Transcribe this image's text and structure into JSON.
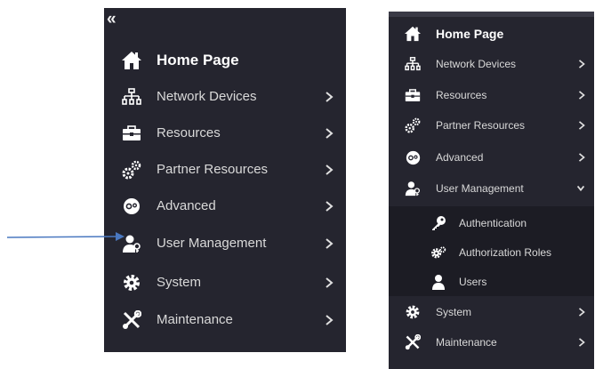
{
  "left_panel": {
    "collapse_glyph": "«",
    "items": [
      {
        "label": "Home Page",
        "icon": "home-icon"
      },
      {
        "label": "Network Devices",
        "icon": "network-icon"
      },
      {
        "label": "Resources",
        "icon": "briefcase-icon"
      },
      {
        "label": "Partner Resources",
        "icon": "gears-icon"
      },
      {
        "label": "Advanced",
        "icon": "advanced-icon"
      },
      {
        "label": "User Management",
        "icon": "user-key-icon"
      },
      {
        "label": "System",
        "icon": "gear-icon"
      },
      {
        "label": "Maintenance",
        "icon": "tools-icon"
      }
    ]
  },
  "right_panel": {
    "items": [
      {
        "label": "Home Page",
        "icon": "home-icon"
      },
      {
        "label": "Network Devices",
        "icon": "network-icon"
      },
      {
        "label": "Resources",
        "icon": "briefcase-icon"
      },
      {
        "label": "Partner Resources",
        "icon": "gears-icon"
      },
      {
        "label": "Advanced",
        "icon": "advanced-icon"
      },
      {
        "label": "User Management",
        "icon": "user-key-icon",
        "expanded": true
      },
      {
        "label": "System",
        "icon": "gear-icon"
      },
      {
        "label": "Maintenance",
        "icon": "tools-icon"
      }
    ],
    "submenu": [
      {
        "label": "Authentication",
        "icon": "key-icon"
      },
      {
        "label": "Authorization Roles",
        "icon": "settings-icon"
      },
      {
        "label": "Users",
        "icon": "user-icon"
      }
    ]
  },
  "annotation": {
    "arrow_color": "#4a78c0",
    "points_to": "User Management"
  },
  "colors": {
    "panel_bg": "#25252f",
    "submenu_bg": "#1c1c24",
    "text": "#d9d9d9",
    "icon": "#ffffff"
  }
}
